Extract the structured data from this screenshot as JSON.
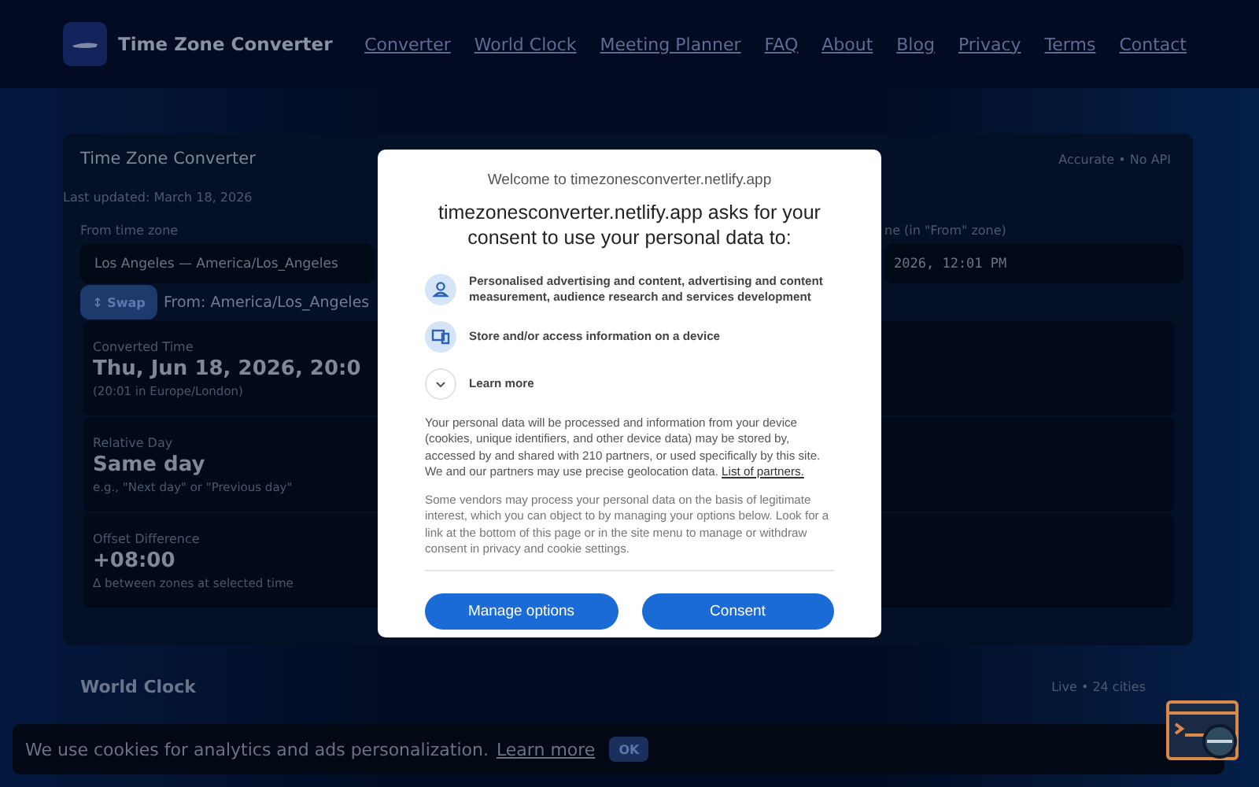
{
  "header": {
    "brand": "Time Zone Converter",
    "nav": [
      "Converter",
      "World Clock",
      "Meeting Planner",
      "FAQ",
      "About",
      "Blog",
      "Privacy",
      "Terms",
      "Contact"
    ]
  },
  "converter": {
    "title": "Time Zone Converter",
    "badge": "Accurate • No API",
    "last_updated": "Last updated: March 18, 2026",
    "from_label": "From time zone",
    "from_value": "Los Angeles — America/Los_Angeles",
    "time_label": "ne (in \"From\" zone)",
    "time_value": "2026, 12:01 PM",
    "swap": "↕ Swap",
    "from_note": "From: America/Los_Angeles",
    "results": [
      {
        "label": "Converted Time",
        "value": "Thu, Jun 18, 2026, 20:0",
        "note": "(20:01 in Europe/London)"
      },
      {
        "label": "Relative Day",
        "value": "Same day",
        "note": "e.g., \"Next day\" or \"Previous day\""
      },
      {
        "label": "Offset Difference",
        "value": "+08:00",
        "note": "Δ between zones at selected time"
      }
    ]
  },
  "world_clock": {
    "title": "World Clock",
    "meta": "Live • 24 cities"
  },
  "cookie_bar": {
    "text": "We use cookies for analytics and ads personalization.",
    "link": "Learn more",
    "button": "OK"
  },
  "consent": {
    "welcome": "Welcome to timezonesconverter.netlify.app",
    "heading": "timezonesconverter.netlify.app asks for your consent to use your personal data to:",
    "purposes": [
      {
        "kind": "person",
        "text": "Personalised advertising and content, advertising and content measurement, audience research and services development"
      },
      {
        "kind": "device",
        "text": "Store and/or access information on a device"
      }
    ],
    "learn_more": "Learn more",
    "paragraph_1": "Your personal data will be processed and information from your device (cookies, unique identifiers, and other device data) may be stored by, accessed by and shared with 210 partners, or used specifically by this site. We and our partners may use precise geolocation data.",
    "partners_link": "List of partners.",
    "paragraph_2": "Some vendors may process your personal data on the basis of legitimate interest, which you can object to by managing your options below. Look for a link at the bottom of this page or in the site menu to manage or withdraw consent in privacy and cookie settings.",
    "buttons": [
      "Manage options",
      "Consent"
    ]
  }
}
